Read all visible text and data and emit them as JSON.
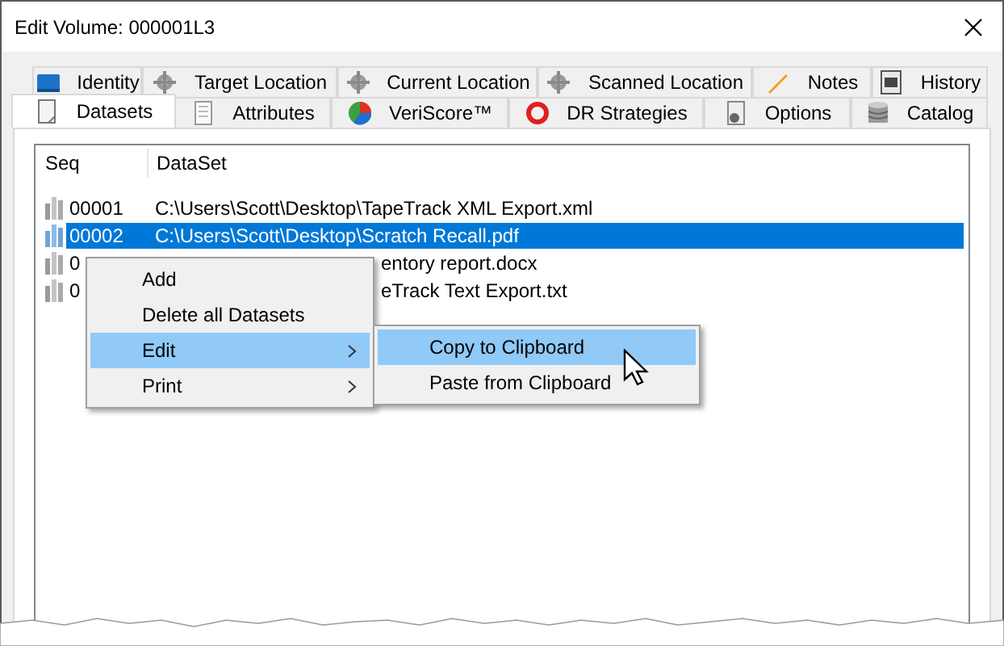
{
  "window": {
    "title": "Edit Volume: 000001L3"
  },
  "tab_rows": [
    [
      {
        "label": "Identity",
        "selected": false
      },
      {
        "label": "Target Location",
        "selected": false
      },
      {
        "label": "Current Location",
        "selected": false
      },
      {
        "label": "Scanned Location",
        "selected": false
      },
      {
        "label": "Notes",
        "selected": false
      },
      {
        "label": "History",
        "selected": false
      }
    ],
    [
      {
        "label": "Datasets",
        "selected": true
      },
      {
        "label": "Attributes",
        "selected": false
      },
      {
        "label": "VeriScore™",
        "selected": false
      },
      {
        "label": "DR Strategies",
        "selected": false
      },
      {
        "label": "Options",
        "selected": false
      },
      {
        "label": "Catalog",
        "selected": false
      }
    ]
  ],
  "table": {
    "columns": [
      "Seq",
      "DataSet"
    ],
    "rows": [
      {
        "seq": "00001",
        "dataset": "C:\\Users\\Scott\\Desktop\\TapeTrack XML Export.xml",
        "selected": false
      },
      {
        "seq": "00002",
        "dataset": "C:\\Users\\Scott\\Desktop\\Scratch Recall.pdf",
        "selected": true
      },
      {
        "seq": "0",
        "dataset": "entory report.docx",
        "selected": false
      },
      {
        "seq": "0",
        "dataset": "eTrack Text Export.txt",
        "selected": false
      }
    ]
  },
  "context_menu": {
    "items": [
      {
        "label": "Add",
        "submenu": false,
        "selected": false
      },
      {
        "label": "Delete all Datasets",
        "submenu": false,
        "selected": false
      },
      {
        "label": "Edit",
        "submenu": true,
        "selected": true
      },
      {
        "label": "Print",
        "submenu": true,
        "selected": false
      }
    ],
    "submenu": [
      {
        "label": "Copy to Clipboard",
        "selected": true
      },
      {
        "label": "Paste from Clipboard",
        "selected": false
      }
    ]
  }
}
